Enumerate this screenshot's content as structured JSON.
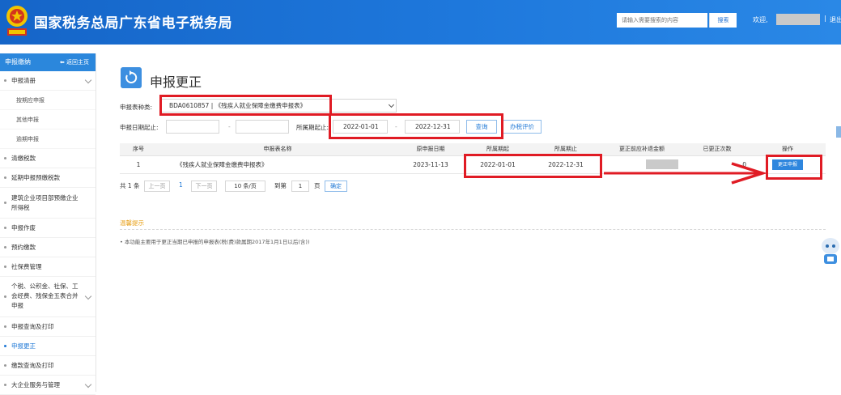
{
  "header": {
    "title": "国家税务总局广东省电子税务局",
    "search_placeholder": "请输入需要搜索的内容",
    "search_button": "搜索",
    "welcome": "欢迎,",
    "separator": "|",
    "logout": "退出",
    "colors": {
      "bar": "#1e78dc",
      "emblem": "#d4351c"
    }
  },
  "sidebar": {
    "head": "申报缴纳",
    "back_home": "返回主页",
    "items": [
      {
        "label": "申报清册",
        "expanded": true
      },
      {
        "label": "按期应申报"
      },
      {
        "label": "其他申报"
      },
      {
        "label": "逾期申报"
      },
      {
        "label": "清缴税款"
      },
      {
        "label": "延期申报预缴税款"
      },
      {
        "label": "建筑企业项目部预缴企业所得税"
      },
      {
        "label": "申报作废"
      },
      {
        "label": "预约缴款"
      },
      {
        "label": "社保费管理"
      },
      {
        "label": "个税、公积金、社保、工会经费、残保金五表合并申报"
      },
      {
        "label": "申报查询及打印"
      },
      {
        "label": "申报更正",
        "active": true
      },
      {
        "label": "缴款查询及打印"
      },
      {
        "label": "大企业服务与管理"
      }
    ]
  },
  "main": {
    "page_title": "申报更正",
    "form": {
      "type_label": "申报表种类:",
      "type_value": "BDA0610857 | 《残疾人就业保障金缴费申报表》",
      "declare_date_label": "申报日期起止:",
      "declare_start": "",
      "declare_end": "",
      "range_sep": "-",
      "period_label": "所属期起止:",
      "period_start": "2022-01-01",
      "period_end": "2022-12-31",
      "query_button": "查询",
      "evaluate_button": "办税评价"
    },
    "table": {
      "headers": [
        "序号",
        "申报表名称",
        "原申报日期",
        "所属期起",
        "所属期止",
        "更正前应补退金额",
        "已更正次数",
        "操作"
      ],
      "rows": [
        {
          "index": "1",
          "name": "《残疾人就业保障金缴费申报表》",
          "original_date": "2023-11-13",
          "period_start": "2022-01-01",
          "period_end": "2022-12-31",
          "amount": "",
          "corrected_count": "0",
          "action": "更正申报"
        }
      ]
    },
    "pagination": {
      "total": "共 1 条",
      "prev": "上一页",
      "current": "1",
      "next": "下一页",
      "page_size": "10 条/页",
      "goto": "到第",
      "goto_value": "1",
      "page_unit": "页",
      "confirm": "确定"
    },
    "tips": {
      "title": "温馨提示",
      "lines": [
        "• 本功能主要用于更正当期已申报的申报表(税(费)款属期2017年1月1日以后(含))"
      ]
    }
  },
  "annotations": {
    "color": "#e01b24"
  }
}
